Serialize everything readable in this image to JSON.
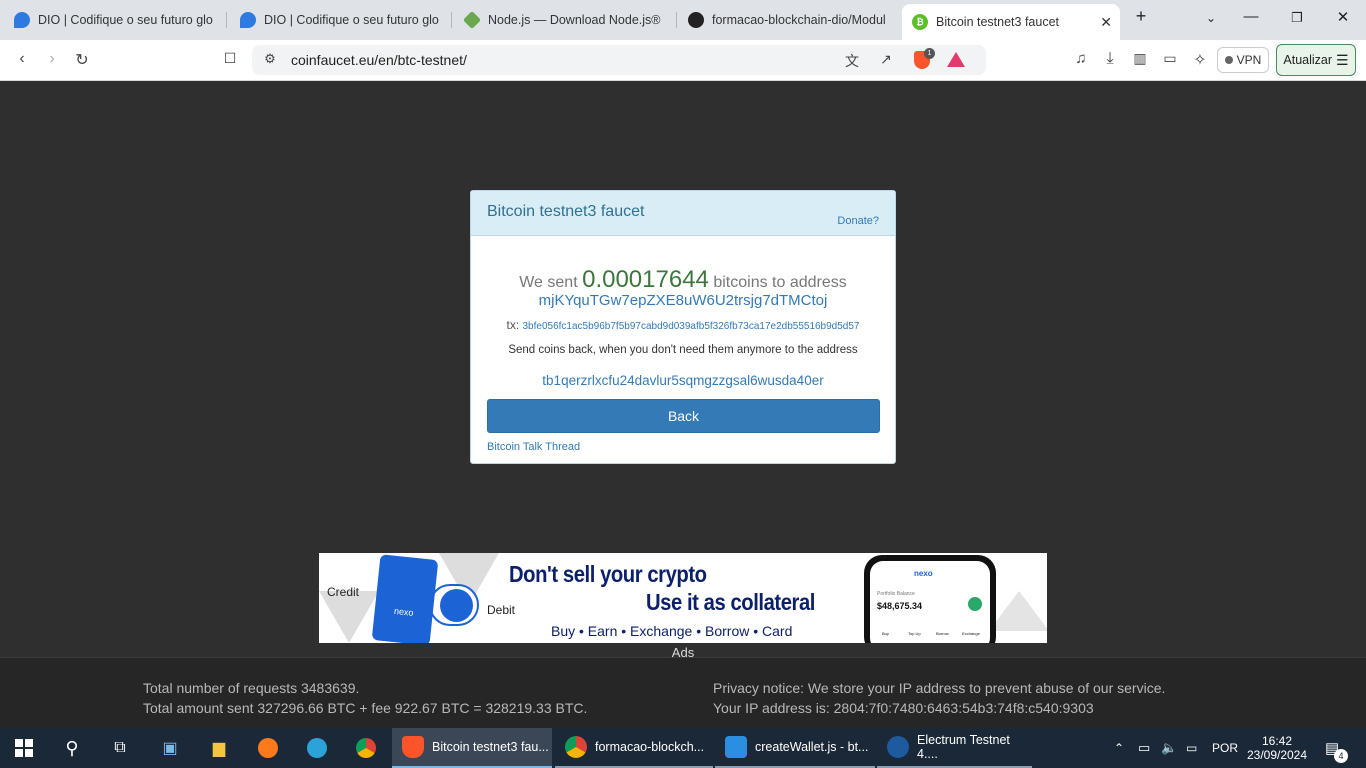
{
  "browser": {
    "tabs": [
      {
        "title": "DIO | Codifique o seu futuro glob",
        "icon": "dio-icon"
      },
      {
        "title": "DIO | Codifique o seu futuro glob",
        "icon": "dio-icon"
      },
      {
        "title": "Node.js — Download Node.js®",
        "icon": "nodejs-icon"
      },
      {
        "title": "formacao-blockchain-dio/Modul",
        "icon": "github-icon"
      },
      {
        "title": "Bitcoin testnet3 faucet",
        "icon": "bitcoin-icon"
      }
    ],
    "url": "coinfaucet.eu/en/btc-testnet/",
    "shields_count": "1",
    "vpn_label": "VPN",
    "update_label": "Atualizar"
  },
  "faucet": {
    "title": "Bitcoin testnet3 faucet",
    "donate_link": "Donate?",
    "sent_prefix": "We sent",
    "amount": "0.00017644",
    "sent_suffix": "bitcoins to address",
    "address": "mjKYquTGw7epZXE8uW6U2trsjg7dTMCtoj",
    "tx_label": "tx:",
    "tx_hash": "3bfe056fc1ac5b96b7f5b97cabd9d039afb5f326fb73ca17e2db55516b9d5d57",
    "send_back_text": "Send coins back, when you don't need them anymore to the address",
    "return_address": "tb1qerzrlxcfu24davlur5sqmgzzgsal6wusda40er",
    "back_button": "Back",
    "thread_link": "Bitcoin Talk Thread"
  },
  "ad": {
    "label": "Ads",
    "brand": "nexo",
    "credit": "Credit",
    "debit": "Debit",
    "headline_1": "Don't sell your crypto",
    "headline_2": "Use it as collateral",
    "subline": "Buy • Earn • Exchange • Borrow • Card",
    "phone_balance_label": "Portfolio Balance",
    "phone_balance": "$48,675.34",
    "phone_actions": [
      "Buy",
      "Top Up",
      "Borrow",
      "Exchange"
    ]
  },
  "footer": {
    "total_requests": "Total number of requests 3483639.",
    "total_sent": "Total amount sent 327296.66 BTC + fee 922.67 BTC = 328219.33 BTC.",
    "privacy": "Privacy notice: We store your IP address to prevent abuse of our service.",
    "ip": "Your IP address is: 2804:7f0:7480:6463:54b3:74f8:c540:9303"
  },
  "taskbar": {
    "apps": [
      {
        "label": "Bitcoin testnet3 fau...",
        "icon": "brave-icon",
        "state": "active"
      },
      {
        "label": "formacao-blockch...",
        "icon": "chrome-icon",
        "state": "open"
      },
      {
        "label": "createWallet.js - bt...",
        "icon": "vscode-icon",
        "state": "open"
      },
      {
        "label": "Electrum Testnet 4....",
        "icon": "electrum-icon",
        "state": "open"
      }
    ],
    "language": "POR",
    "time": "16:42",
    "date": "23/09/2024",
    "notifications": "4"
  },
  "colors": {
    "accent": "#337ab7",
    "amount_green": "#3c763d",
    "page_bg": "#2f2f2f",
    "card_header": "#d9edf7"
  }
}
